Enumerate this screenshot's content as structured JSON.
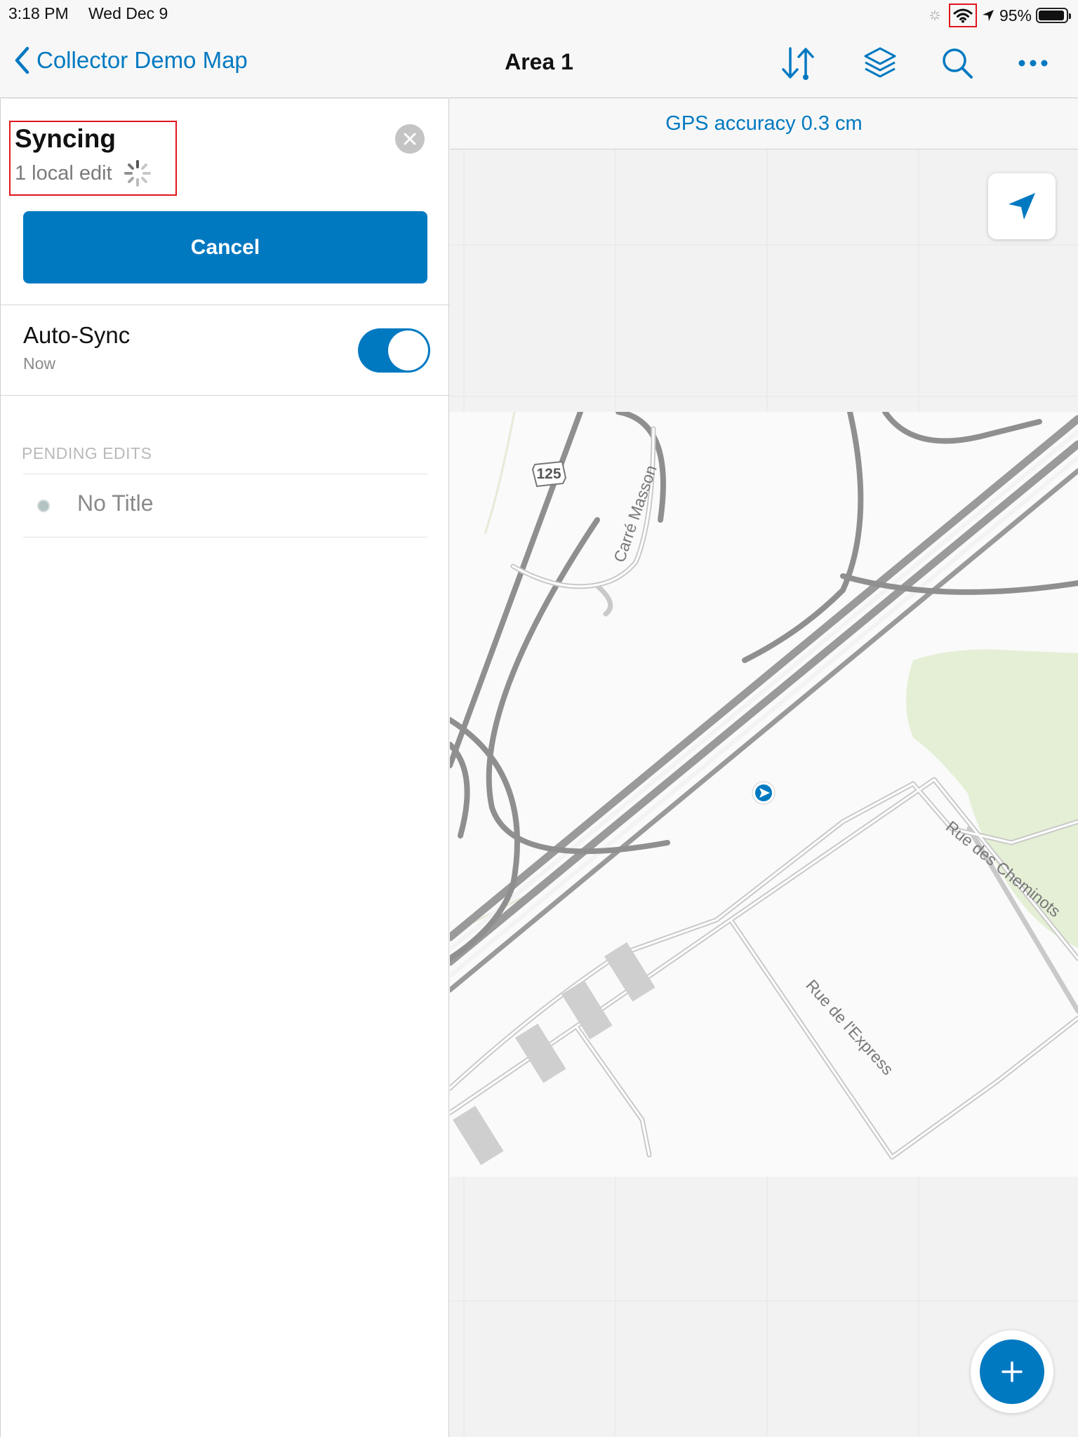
{
  "status_bar": {
    "time": "3:18 PM",
    "date": "Wed Dec 9",
    "battery_text": "95%",
    "battery_level": 0.95
  },
  "nav": {
    "back_label": "Collector Demo Map",
    "title": "Area 1",
    "icons": [
      "sync-icon",
      "layers-icon",
      "search-icon",
      "more-icon"
    ]
  },
  "sync_panel": {
    "title": "Syncing",
    "subtitle": "1 local edit",
    "cancel_label": "Cancel",
    "auto_sync": {
      "label": "Auto-Sync",
      "sub": "Now",
      "enabled": true
    },
    "pending_header": "PENDING EDITS",
    "pending_items": [
      {
        "title": "No Title"
      }
    ]
  },
  "map": {
    "gps_text": "GPS accuracy 0.3 cm",
    "labels": {
      "route": "125",
      "street_1": "Carré Masson",
      "street_2": "Rue des Cheminots",
      "street_3": "Rue de l'Express"
    }
  },
  "colors": {
    "accent": "#0079c1",
    "highlight_box": "#e0151c",
    "park": "#e4efd5"
  }
}
